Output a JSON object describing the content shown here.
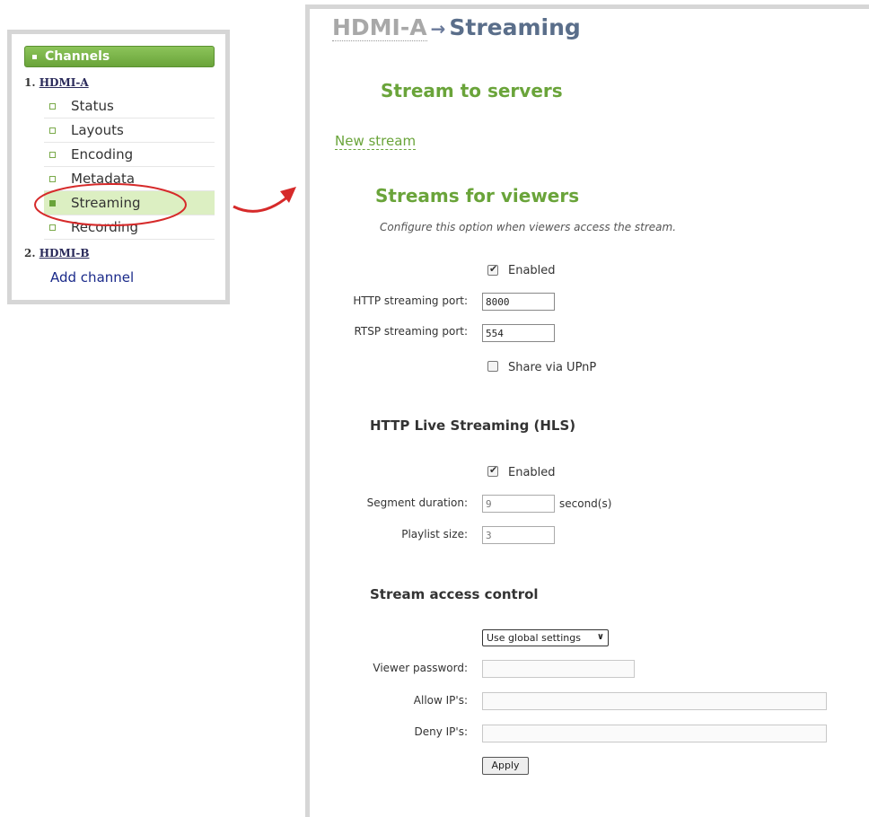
{
  "sidebar": {
    "header": "Channels",
    "channel1": {
      "number": "1.",
      "name": "HDMI-A"
    },
    "items": [
      "Status",
      "Layouts",
      "Encoding",
      "Metadata",
      "Streaming",
      "Recording"
    ],
    "active_item": "Streaming",
    "channel2": {
      "number": "2.",
      "name": "HDMI-B"
    },
    "add_channel": "Add channel"
  },
  "breadcrumb": {
    "parent": "HDMI-A",
    "arrow": "→",
    "current": "Streaming"
  },
  "stream_to_servers": {
    "title": "Stream to servers",
    "new_stream": "New stream"
  },
  "streams_for_viewers": {
    "title": "Streams for viewers",
    "description": "Configure this option when viewers access the stream.",
    "enabled_label": "Enabled",
    "enabled": true,
    "http_port_label": "HTTP streaming port:",
    "http_port": "8000",
    "rtsp_port_label": "RTSP streaming port:",
    "rtsp_port": "554",
    "upnp_label": "Share via UPnP",
    "upnp": false
  },
  "hls": {
    "title": "HTTP Live Streaming (HLS)",
    "enabled_label": "Enabled",
    "enabled": true,
    "segment_label": "Segment duration:",
    "segment_value": "9",
    "segment_unit": "second(s)",
    "playlist_label": "Playlist size:",
    "playlist_value": "3"
  },
  "access_control": {
    "title": "Stream access control",
    "mode": "Use global settings",
    "password_label": "Viewer password:",
    "allow_label": "Allow IP's:",
    "deny_label": "Deny IP's:",
    "apply": "Apply"
  },
  "colors": {
    "accent_green": "#6aa43a",
    "highlight": "#dcefc2",
    "annotation_red": "#d62a2a"
  }
}
